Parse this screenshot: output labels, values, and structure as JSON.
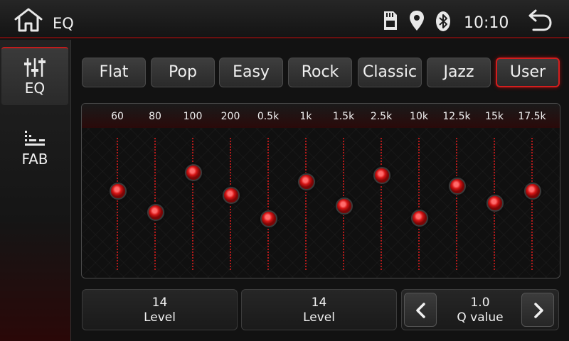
{
  "header": {
    "title": "EQ",
    "time": "10:10",
    "icons": [
      "home-icon",
      "sd-card-icon",
      "location-pin-icon",
      "bluetooth-icon",
      "back-arrow-icon"
    ]
  },
  "sidebar": {
    "items": [
      {
        "label": "EQ",
        "icon": "equalizer-sliders-icon",
        "active": true
      },
      {
        "label": "FAB",
        "icon": "fader-balance-icon",
        "active": false
      }
    ]
  },
  "presets": [
    {
      "label": "Flat",
      "selected": false
    },
    {
      "label": "Pop",
      "selected": false
    },
    {
      "label": "Easy",
      "selected": false
    },
    {
      "label": "Rock",
      "selected": false
    },
    {
      "label": "Classic",
      "selected": false
    },
    {
      "label": "Jazz",
      "selected": false
    },
    {
      "label": "User",
      "selected": true
    }
  ],
  "eq": {
    "bands": [
      "60",
      "80",
      "100",
      "200",
      "0.5k",
      "1k",
      "1.5k",
      "2.5k",
      "10k",
      "12.5k",
      "15k",
      "17.5k"
    ],
    "levels_fraction": [
      0.6,
      0.44,
      0.74,
      0.57,
      0.39,
      0.67,
      0.49,
      0.72,
      0.4,
      0.64,
      0.51,
      0.6
    ]
  },
  "controls": {
    "level_1": {
      "value": "14",
      "label": "Level"
    },
    "level_2": {
      "value": "14",
      "label": "Level"
    },
    "q": {
      "value": "1.0",
      "label": "Q value"
    }
  },
  "colors": {
    "accent": "#d41e1e",
    "background": "#121212"
  }
}
